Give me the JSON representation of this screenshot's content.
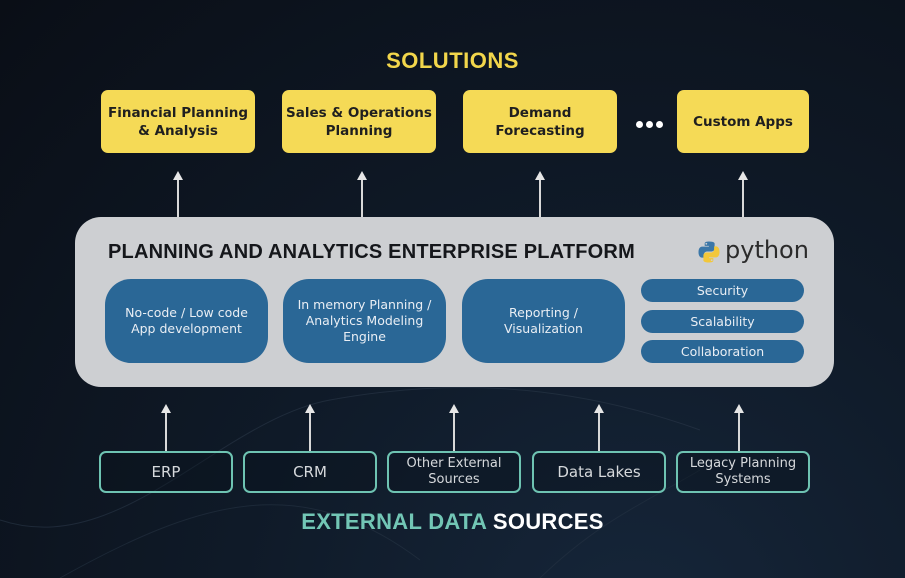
{
  "solutions": {
    "title": "SOLUTIONS",
    "items": [
      {
        "label": "Financial Planning & Analysis"
      },
      {
        "label": "Sales & Operations Planning"
      },
      {
        "label": "Demand Forecasting"
      },
      {
        "label": "Custom Apps"
      }
    ],
    "more_indicator": "ellipsis-icon"
  },
  "platform": {
    "title": "PLANNING AND ANALYTICS ENTERPRISE PLATFORM",
    "logo_text": "python",
    "logo_icon": "python-logo-icon",
    "modules": [
      {
        "label": "No-code / Low code App development"
      },
      {
        "label": "In memory Planning / Analytics Modeling Engine"
      },
      {
        "label": "Reporting / Visualization"
      }
    ],
    "capabilities": [
      {
        "label": "Security"
      },
      {
        "label": "Scalability"
      },
      {
        "label": "Collaboration"
      }
    ]
  },
  "sources": {
    "title_part1": "EXTERNAL DATA",
    "title_part2": "SOURCES",
    "items": [
      {
        "label": "ERP"
      },
      {
        "label": "CRM"
      },
      {
        "label": "Other External Sources"
      },
      {
        "label": "Data Lakes"
      },
      {
        "label": "Legacy Planning Systems"
      }
    ]
  },
  "colors": {
    "solution_yellow": "#f5da56",
    "platform_gray": "#cdcfd2",
    "module_blue": "#2a6796",
    "source_teal": "#6ec3b2",
    "background": "#0a0e16"
  }
}
